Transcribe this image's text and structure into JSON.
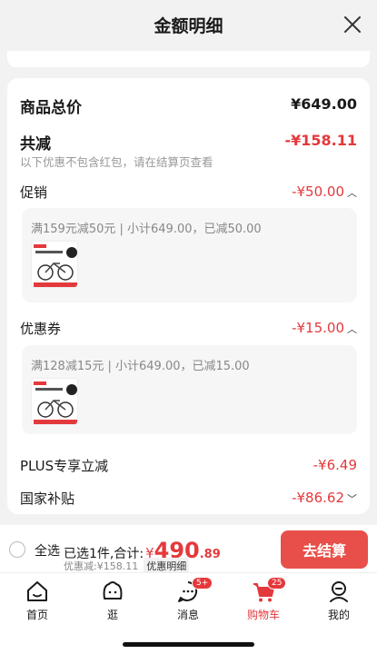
{
  "header": {
    "title": "金额明细"
  },
  "summary": {
    "goods_total_label": "商品总价",
    "goods_total_value": "¥649.00",
    "discount_total_label": "共减",
    "discount_total_value": "-¥158.11",
    "discount_note": "以下优惠不包含红包，请在结算页查看"
  },
  "promotion": {
    "label": "促销",
    "value": "-¥50.00",
    "detail": "满159元减50元 | 小计649.00，已减50.00"
  },
  "coupon": {
    "label": "优惠券",
    "value": "-¥15.00",
    "detail": "满128减15元 | 小计649.00，已减15.00"
  },
  "plus": {
    "label": "PLUS专享立减",
    "value": "-¥6.49"
  },
  "subsidy": {
    "label": "国家补贴",
    "value": "-¥86.62"
  },
  "bottom": {
    "select_all": "全选",
    "selected_text": "已选1件,合计:",
    "currency": "¥",
    "total_integer": "490",
    "total_decimal": ".89",
    "discount_text": "优惠减:¥158.11",
    "discount_detail_link": "优惠明细",
    "checkout": "去结算"
  },
  "tabs": [
    {
      "label": "首页",
      "icon": "home-icon"
    },
    {
      "label": "逛",
      "icon": "browse-face-icon"
    },
    {
      "label": "消息",
      "icon": "message-icon",
      "badge": "5+"
    },
    {
      "label": "购物车",
      "icon": "cart-icon",
      "badge": "25",
      "active": true
    },
    {
      "label": "我的",
      "icon": "profile-icon"
    }
  ],
  "colors": {
    "accent": "#e4393c",
    "checkout": "#e84f4a"
  }
}
